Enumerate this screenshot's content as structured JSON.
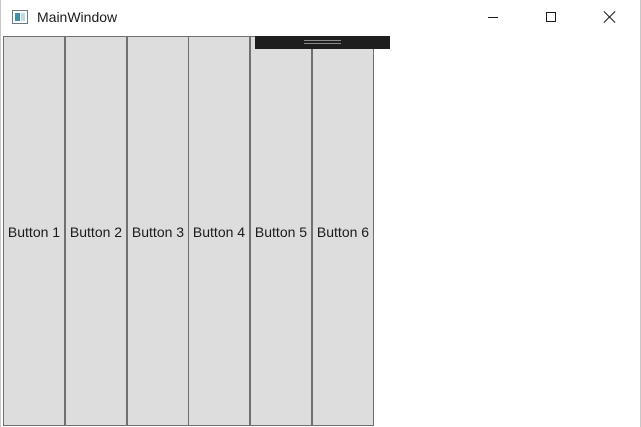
{
  "window": {
    "title": "MainWindow"
  },
  "icons": {
    "app": "window-app-icon",
    "minimize": "minimize-icon",
    "maximize": "maximize-icon",
    "close": "close-icon"
  },
  "buttons": [
    {
      "label": "Button 1"
    },
    {
      "label": "Button 2"
    },
    {
      "label": "Button 3"
    },
    {
      "label": "Button 4"
    },
    {
      "label": "Button 5"
    },
    {
      "label": "Button 6"
    }
  ],
  "colors": {
    "button_face": "#dddddd",
    "button_border": "#707070",
    "toolbar": "#1e1e1e",
    "window_bg": "#ffffff"
  }
}
